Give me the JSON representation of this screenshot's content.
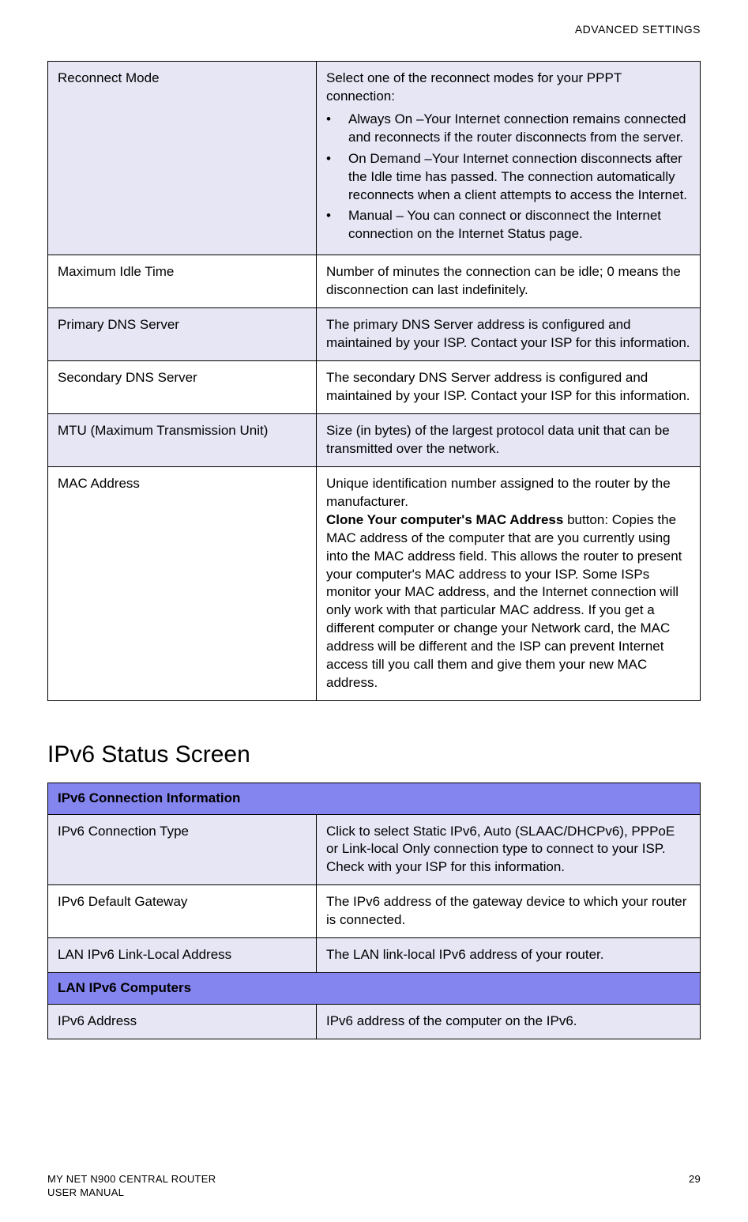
{
  "header": {
    "section": "ADVANCED SETTINGS"
  },
  "table1": {
    "rows": [
      {
        "label": "Reconnect Mode",
        "intro": "Select one of the reconnect modes for your PPPT connection:",
        "bullets": [
          "Always On –Your Internet connection remains connected and reconnects if the router disconnects from the server.",
          "On Demand –Your Internet connection disconnects after the Idle time has passed. The connection automatically reconnects when a client attempts to access the Internet.",
          "Manual – You can connect or disconnect the Internet connection on the Internet Status page."
        ]
      },
      {
        "label": "Maximum Idle Time",
        "desc": "Number of minutes the connection can be idle; 0 means the disconnection can last indefinitely."
      },
      {
        "label": "Primary DNS Server",
        "desc": "The primary DNS Server address is configured and maintained by your ISP. Contact your ISP for this information."
      },
      {
        "label": "Secondary DNS Server",
        "desc": "The secondary DNS Server address is configured and maintained by your ISP. Contact your ISP for this information."
      },
      {
        "label": "MTU (Maximum Transmission Unit)",
        "desc": "Size (in bytes) of the largest protocol data unit that can be transmitted over the network."
      },
      {
        "label": "MAC Address",
        "desc_p1": "Unique identification number assigned to the router by the manufacturer.",
        "bold": "Clone Your computer's MAC Address",
        "desc_p2_after_bold": " button: Copies the MAC address of the computer that are you currently using into the MAC address field. This allows the router to present your computer's MAC address to your ISP. Some ISPs monitor your MAC address, and the Internet connection will only work with that particular MAC address. If you get a different computer or change your Network card, the MAC address will be different and the ISP can prevent Internet access till you call them and give them your new MAC address."
      }
    ]
  },
  "heading2": "IPv6 Status Screen",
  "table2": {
    "section1": "IPv6 Connection Information",
    "rows1": [
      {
        "label": "IPv6 Connection Type",
        "desc": "Click to select Static IPv6, Auto (SLAAC/DHCPv6), PPPoE or Link-local Only connection type to connect to your ISP. Check with your ISP for this information."
      },
      {
        "label": "IPv6 Default Gateway",
        "desc": "The IPv6 address of the gateway device to which your router is connected."
      },
      {
        "label": "LAN IPv6 Link-Local Address",
        "desc": "The LAN link-local IPv6 address of your router."
      }
    ],
    "section2": "LAN IPv6 Computers",
    "rows2": [
      {
        "label": "IPv6 Address",
        "desc": "IPv6 address of the computer on the IPv6."
      }
    ]
  },
  "footer": {
    "left1": "MY NET N900 CENTRAL ROUTER",
    "left2": "USER MANUAL",
    "right": "29"
  }
}
